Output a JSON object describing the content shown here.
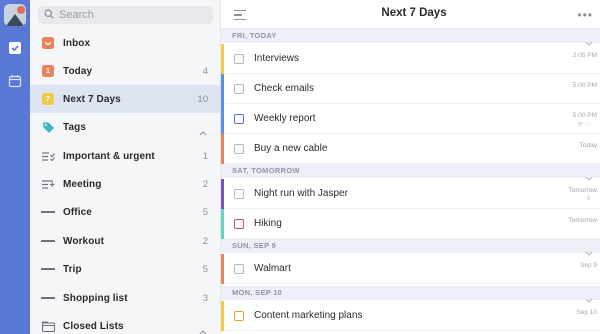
{
  "sidebar": {
    "search_placeholder": "Search",
    "items": [
      {
        "label": "Inbox",
        "count": ""
      },
      {
        "label": "Today",
        "count": "4"
      },
      {
        "label": "Next 7 Days",
        "count": "10"
      },
      {
        "label": "Tags",
        "count": ""
      },
      {
        "label": "Important & urgent",
        "count": "1"
      },
      {
        "label": "Meeting",
        "count": "2"
      },
      {
        "label": "Office",
        "count": "5"
      },
      {
        "label": "Workout",
        "count": "2"
      },
      {
        "label": "Trip",
        "count": "5"
      },
      {
        "label": "Shopping list",
        "count": "3"
      },
      {
        "label": "Closed Lists",
        "count": ""
      }
    ]
  },
  "main": {
    "title": "Next 7 Days",
    "sections": [
      {
        "label": "FRI, TODAY"
      },
      {
        "label": "SAT, TOMORROW"
      },
      {
        "label": "SUN, SEP 9"
      },
      {
        "label": "MON, SEP 10"
      }
    ],
    "tasks": [
      {
        "title": "Interviews",
        "date": "2:05 PM",
        "stripe": "#f2c94c",
        "check": "#b5b8c0"
      },
      {
        "title": "Check emails",
        "date": "5:00 PM",
        "stripe": "#5b8def",
        "check": "#b5b8c0"
      },
      {
        "title": "Weekly report",
        "date": "5:00 PM",
        "stripe": "#5b8def",
        "check": "#5b6ccf"
      },
      {
        "title": "Buy a new cable",
        "date": "Today",
        "stripe": "#e8835a",
        "check": "#b5b8c0"
      },
      {
        "title": "Night run with Jasper",
        "date": "Tomorrow",
        "stripe": "#7b4fc9",
        "check": "#b5b8c0"
      },
      {
        "title": "Hiking",
        "date": "Tomorrow",
        "stripe": "#65d3c4",
        "check": "#d9465a"
      },
      {
        "title": "Walmart",
        "date": "Sep 9",
        "stripe": "#e8835a",
        "check": "#b5b8c0"
      },
      {
        "title": "Content marketing plans",
        "date": "Sep 10",
        "stripe": "#f2c94c",
        "check": "#e5a82a"
      }
    ]
  },
  "colors": {
    "rail": "#5a78d6",
    "accent": "#5a78d6",
    "active_item_bg": "#dfe4f3"
  }
}
